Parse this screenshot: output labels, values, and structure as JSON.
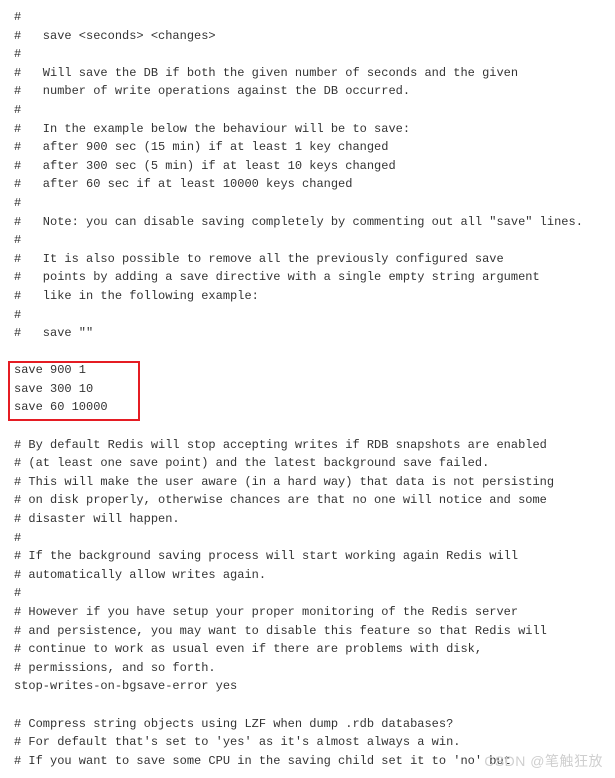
{
  "block1": [
    "#",
    "#   save <seconds> <changes>",
    "#",
    "#   Will save the DB if both the given number of seconds and the given",
    "#   number of write operations against the DB occurred.",
    "#",
    "#   In the example below the behaviour will be to save:",
    "#   after 900 sec (15 min) if at least 1 key changed",
    "#   after 300 sec (5 min) if at least 10 keys changed",
    "#   after 60 sec if at least 10000 keys changed",
    "#",
    "#   Note: you can disable saving completely by commenting out all \"save\" lines.",
    "#",
    "#   It is also possible to remove all the previously configured save",
    "#   points by adding a save directive with a single empty string argument",
    "#   like in the following example:",
    "#",
    "#   save \"\"",
    ""
  ],
  "highlighted": [
    "save 900 1",
    "save 300 10",
    "save 60 10000"
  ],
  "block2": [
    "",
    "# By default Redis will stop accepting writes if RDB snapshots are enabled",
    "# (at least one save point) and the latest background save failed.",
    "# This will make the user aware (in a hard way) that data is not persisting",
    "# on disk properly, otherwise chances are that no one will notice and some",
    "# disaster will happen.",
    "#",
    "# If the background saving process will start working again Redis will",
    "# automatically allow writes again.",
    "#",
    "# However if you have setup your proper monitoring of the Redis server",
    "# and persistence, you may want to disable this feature so that Redis will",
    "# continue to work as usual even if there are problems with disk,",
    "# permissions, and so forth.",
    "stop-writes-on-bgsave-error yes",
    "",
    "# Compress string objects using LZF when dump .rdb databases?",
    "# For default that's set to 'yes' as it's almost always a win.",
    "# If you want to save some CPU in the saving child set it to 'no' but"
  ],
  "watermark": "CSDN @笔触狂放"
}
